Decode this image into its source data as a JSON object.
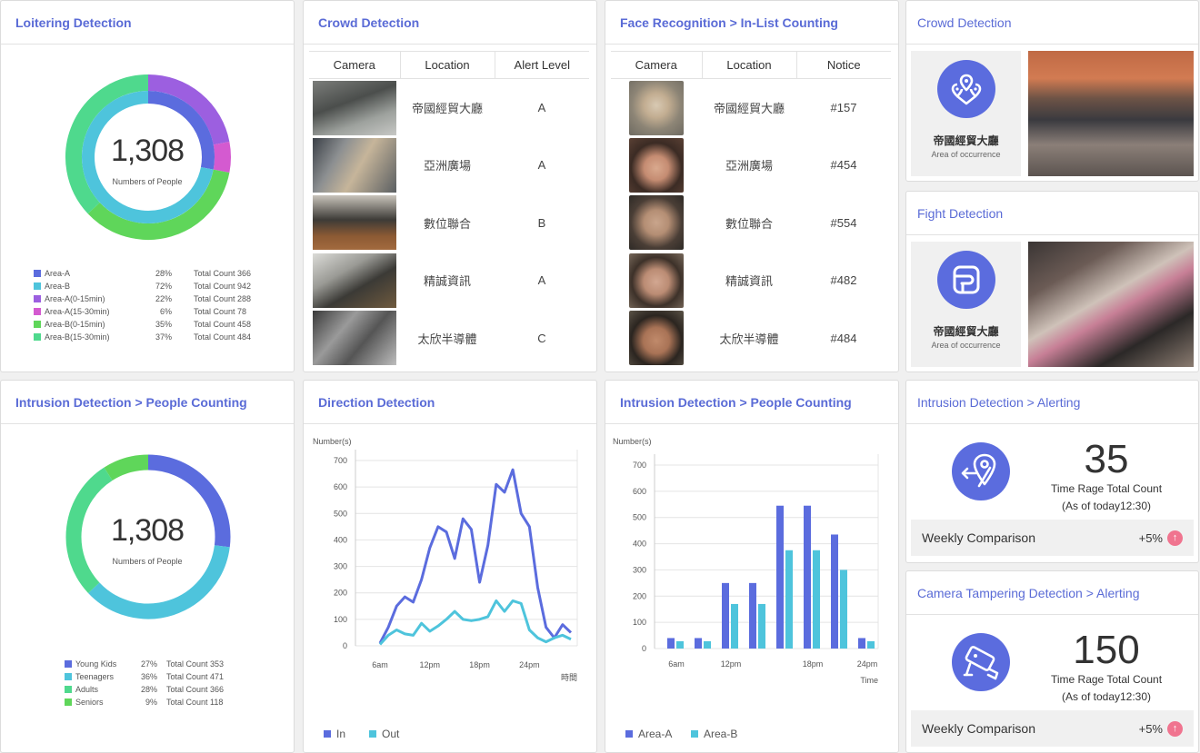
{
  "colors": {
    "accent": "#5a6bd6",
    "blue": "#5b6cde",
    "cyan": "#4ec4dc",
    "purple": "#9c5fe0",
    "magenta": "#d45ad0",
    "green": "#5fd65a",
    "mint": "#4fd98d",
    "pink": "#f0748f"
  },
  "loitering": {
    "title": "Loitering Detection",
    "count": "1,308",
    "count_label": "Numbers of People",
    "legend": [
      {
        "name": "Area-A",
        "pct": "28%",
        "total": "Total Count 366",
        "color": "#5b6cde"
      },
      {
        "name": "Area-B",
        "pct": "72%",
        "total": "Total Count 942",
        "color": "#4ec4dc"
      },
      {
        "name": "Area-A(0-15min)",
        "pct": "22%",
        "total": "Total Count 288",
        "color": "#9c5fe0"
      },
      {
        "name": "Area-A(15-30min)",
        "pct": "6%",
        "total": "Total Count 78",
        "color": "#d45ad0"
      },
      {
        "name": "Area-B(0-15min)",
        "pct": "35%",
        "total": "Total Count 458",
        "color": "#5fd65a"
      },
      {
        "name": "Area-B(15-30min)",
        "pct": "37%",
        "total": "Total Count 484",
        "color": "#4fd98d"
      }
    ]
  },
  "crowd_table": {
    "title": "Crowd Detection",
    "headers": [
      "Camera",
      "Location",
      "Alert Level"
    ],
    "rows": [
      {
        "location": "帝國經貿大廳",
        "level": "A"
      },
      {
        "location": "亞洲廣場",
        "level": "A"
      },
      {
        "location": "數位聯合",
        "level": "B"
      },
      {
        "location": "精誠資訊",
        "level": "A"
      },
      {
        "location": "太欣半導體",
        "level": "C"
      }
    ]
  },
  "face": {
    "title": "Face Recognition > In-List Counting",
    "headers": [
      "Camera",
      "Location",
      "Notice"
    ],
    "rows": [
      {
        "location": "帝國經貿大廳",
        "notice": "#157"
      },
      {
        "location": "亞洲廣場",
        "notice": "#454"
      },
      {
        "location": "數位聯合",
        "notice": "#554"
      },
      {
        "location": "精誠資訊",
        "notice": "#482"
      },
      {
        "location": "太欣半導體",
        "notice": "#484"
      }
    ]
  },
  "crowd_card": {
    "title": "Crowd Detection",
    "place": "帝國經貿大廳",
    "place_sub": "Area of occurrence"
  },
  "fight_card": {
    "title": "Fight Detection",
    "place": "帝國經貿大廳",
    "place_sub": "Area of occurrence"
  },
  "intrusion_count": {
    "title": "Intrusion Detection > People Counting",
    "count": "1,308",
    "count_label": "Numbers of People",
    "legend": [
      {
        "name": "Young Kids",
        "pct": "27%",
        "total": "Total Count 353",
        "color": "#5b6cde"
      },
      {
        "name": "Teenagers",
        "pct": "36%",
        "total": "Total Count 471",
        "color": "#4ec4dc"
      },
      {
        "name": "Adults",
        "pct": "28%",
        "total": "Total Count 366",
        "color": "#4fd98d"
      },
      {
        "name": "Seniors",
        "pct": "9%",
        "total": "Total Count 118",
        "color": "#5fd65a"
      }
    ]
  },
  "direction": {
    "title": "Direction Detection"
  },
  "intrusion_bar": {
    "title": "Intrusion Detection > People Counting"
  },
  "intrusion_alert": {
    "title": "Intrusion Detection > Alerting",
    "number": "35",
    "line1": "Time Rage Total Count",
    "line2": "(As of today12:30)",
    "weekly_label": "Weekly Comparison",
    "weekly_value": "+5%"
  },
  "tamper_alert": {
    "title": "Camera Tampering Detection > Alerting",
    "number": "150",
    "line1": "Time Rage Total Count",
    "line2": "(As of today12:30)",
    "weekly_label": "Weekly Comparison",
    "weekly_value": "+5%"
  },
  "chart_data": [
    {
      "type": "pie",
      "title": "Loitering Detection",
      "series": [
        {
          "name": "Area",
          "labels": [
            "Area-A",
            "Area-B"
          ],
          "values": [
            28,
            72
          ]
        },
        {
          "name": "Duration",
          "labels": [
            "Area-A(0-15min)",
            "Area-A(15-30min)",
            "Area-B(0-15min)",
            "Area-B(15-30min)"
          ],
          "values": [
            22,
            6,
            35,
            37
          ]
        }
      ]
    },
    {
      "type": "pie",
      "title": "Intrusion Detection > People Counting",
      "labels": [
        "Young Kids",
        "Teenagers",
        "Adults",
        "Seniors"
      ],
      "values": [
        27,
        36,
        28,
        9
      ]
    },
    {
      "type": "line",
      "title": "Direction Detection",
      "ylabel": "Number(s)",
      "xlabel": "時間",
      "ylim": [
        0,
        700
      ],
      "yticks": [
        0,
        100,
        200,
        300,
        400,
        500,
        600,
        700
      ],
      "xtick_labels": [
        "6am",
        "12pm",
        "18pm",
        "24pm"
      ],
      "xtick_index": [
        0,
        6,
        12,
        18
      ],
      "legend": "bottom",
      "series": [
        {
          "name": "In",
          "color": "#5b6cde",
          "values": [
            10,
            70,
            150,
            185,
            165,
            250,
            370,
            450,
            430,
            330,
            480,
            440,
            240,
            380,
            610,
            580,
            665,
            500,
            450,
            220,
            70,
            30,
            80,
            50
          ]
        },
        {
          "name": "Out",
          "color": "#4ec4dc",
          "values": [
            5,
            40,
            60,
            45,
            40,
            85,
            55,
            75,
            100,
            130,
            100,
            95,
            100,
            110,
            170,
            130,
            170,
            160,
            60,
            30,
            15,
            30,
            40,
            25
          ]
        }
      ]
    },
    {
      "type": "bar",
      "title": "Intrusion Detection > People Counting",
      "ylabel": "Number(s)",
      "xlabel": "Time",
      "ylim": [
        0,
        700
      ],
      "yticks": [
        0,
        100,
        200,
        300,
        400,
        500,
        600,
        700
      ],
      "xtick_labels": [
        "6am",
        "12pm",
        "18pm",
        "24pm"
      ],
      "xtick_index": [
        0,
        2,
        5,
        7
      ],
      "legend": "bottom",
      "series": [
        {
          "name": "Area-A",
          "color": "#5b6cde",
          "values": [
            40,
            40,
            250,
            250,
            545,
            545,
            435,
            40
          ]
        },
        {
          "name": "Area-B",
          "color": "#4ec4dc",
          "values": [
            28,
            28,
            170,
            170,
            375,
            375,
            300,
            28
          ]
        }
      ]
    }
  ]
}
